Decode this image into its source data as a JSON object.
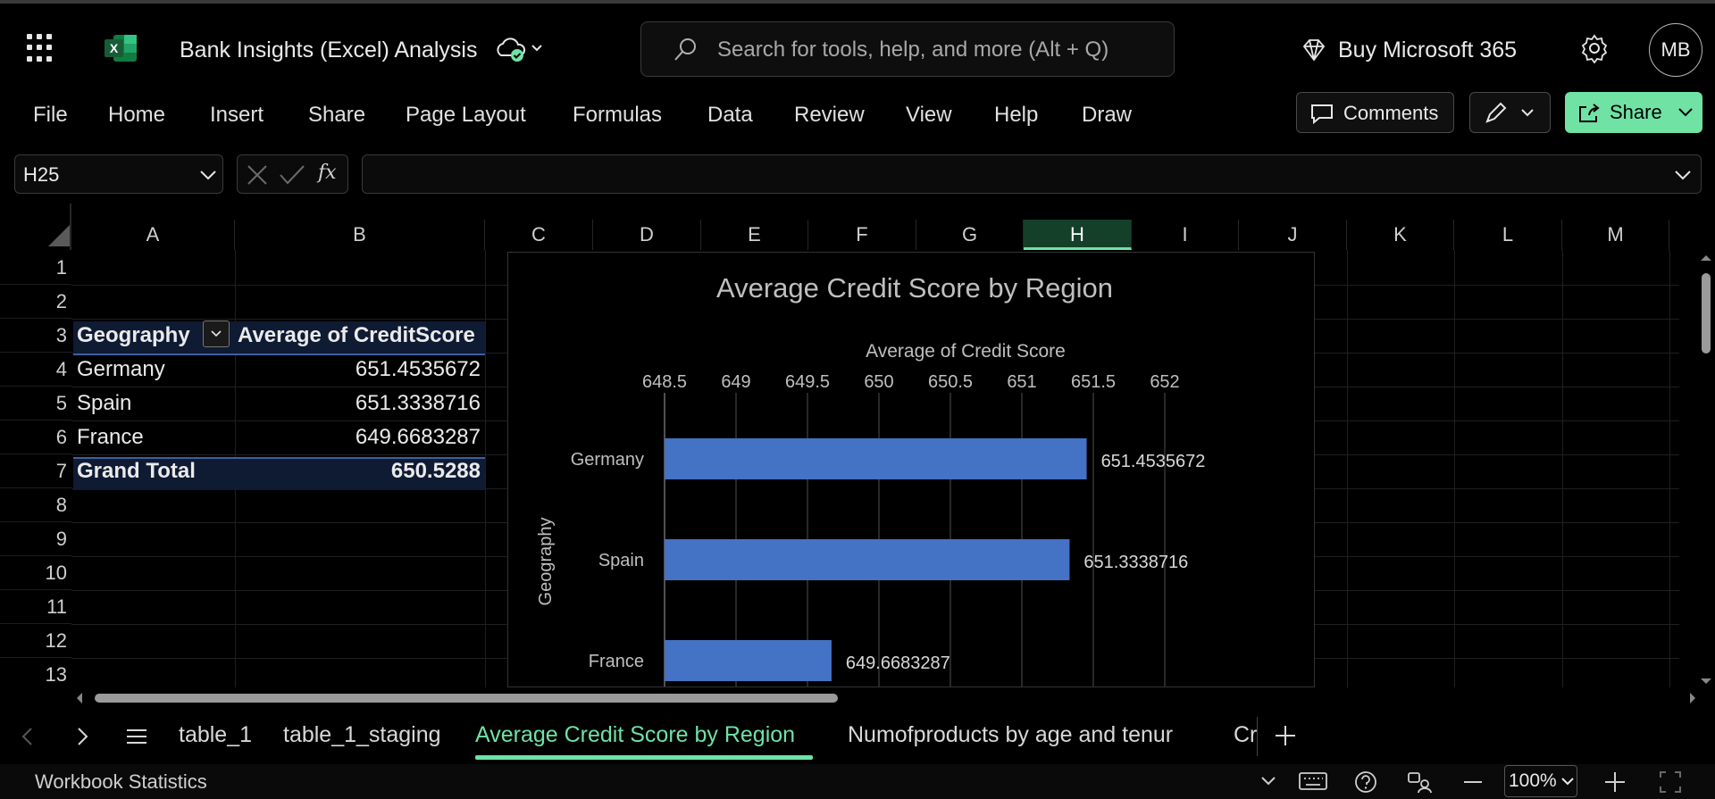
{
  "titlebar": {
    "doc_title": "Bank Insights (Excel) Analysis",
    "search_placeholder": "Search for tools, help, and more (Alt + Q)",
    "buy_label": "Buy Microsoft 365",
    "avatar_initials": "MB",
    "logo_letter": "X"
  },
  "ribbon": {
    "tabs": [
      "File",
      "Home",
      "Insert",
      "Share",
      "Page Layout",
      "Formulas",
      "Data",
      "Review",
      "View",
      "Help",
      "Draw"
    ],
    "comments_label": "Comments",
    "share_label": "Share"
  },
  "formula_bar": {
    "name_box": "H25",
    "fx_label": "fx",
    "formula": ""
  },
  "grid": {
    "columns": [
      "A",
      "B",
      "C",
      "D",
      "E",
      "F",
      "G",
      "H",
      "I",
      "J",
      "K",
      "L",
      "M"
    ],
    "selected_column": "H",
    "rows": [
      "1",
      "2",
      "3",
      "4",
      "5",
      "6",
      "7",
      "8",
      "9",
      "10",
      "11",
      "12",
      "13"
    ]
  },
  "pivot": {
    "header": [
      "Geography",
      "Average of CreditScore"
    ],
    "rows": [
      {
        "label": "Germany",
        "value": "651.4535672"
      },
      {
        "label": "Spain",
        "value": "651.3338716"
      },
      {
        "label": "France",
        "value": "649.6683287"
      }
    ],
    "total": {
      "label": "Grand Total",
      "value": "650.5288"
    }
  },
  "chart_data": {
    "type": "bar",
    "orientation": "horizontal",
    "title": "Average Credit Score by Region",
    "xlabel": "Average of Credit Score",
    "ylabel": "Geography",
    "categories": [
      "Germany",
      "Spain",
      "France"
    ],
    "values": [
      651.4535672,
      651.3338716,
      649.6683287
    ],
    "data_labels": [
      "651.4535672",
      "651.3338716",
      "649.6683287"
    ],
    "xlim": [
      648.5,
      652
    ],
    "x_ticks": [
      "648.5",
      "649",
      "649.5",
      "650",
      "650.5",
      "651",
      "651.5",
      "652"
    ],
    "x_axis_position": "top",
    "grid": true,
    "legend": "none",
    "bar_color": "#4472c4"
  },
  "sheets": {
    "tabs": [
      "table_1",
      "table_1_staging",
      "Average Credit Score by Region",
      "Numofproducts by age and tenur",
      "Cr"
    ],
    "active": "Average Credit Score by Region"
  },
  "status": {
    "left": "Workbook Statistics",
    "zoom": "100%"
  },
  "colors": {
    "accent": "#6fe2a4",
    "excel_green": "#21a366",
    "pivot_header_bg": "#0f1a33"
  }
}
